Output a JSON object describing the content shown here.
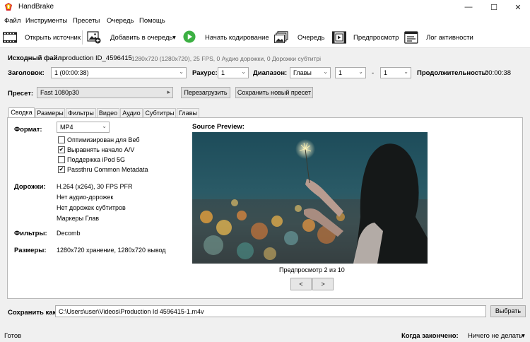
{
  "app": {
    "title": "HandBrake"
  },
  "window_controls": {
    "minimize": "—",
    "maximize": "☐",
    "close": "✕"
  },
  "menu": [
    "Файл",
    "Инструменты",
    "Пресеты",
    "Очередь",
    "Помощь"
  ],
  "toolbar": {
    "open_source": "Открыть источник",
    "add_queue": "Добавить в очередь",
    "add_queue_arrow": "▾",
    "start_encode": "Начать кодирование",
    "queue": "Очередь",
    "preview": "Предпросмотр",
    "activity_log": "Лог активности"
  },
  "source": {
    "label": "Исходный файл:",
    "name": "production ID_4596415",
    "info": "1280x720 (1280x720), 25 FPS, 0 Аудио дорожки, 0 Дорожки субтитрі"
  },
  "title_row": {
    "title_label": "Заголовок:",
    "title_value": "1 (00:00:38)",
    "angle_label": "Ракурс:",
    "angle_value": "1",
    "range_label": "Диапазон:",
    "range_type": "Главы",
    "range_start": "1",
    "range_dash": "-",
    "range_end": "1",
    "duration_label": "Продолжительность:",
    "duration_value": "00:00:38"
  },
  "preset": {
    "label": "Пресет:",
    "value": "Fast 1080p30",
    "arrow": "▸",
    "reload_button": "Перезагрузить",
    "save_new_button": "Сохранить новый пресет"
  },
  "tabs": [
    "Сводка",
    "Размеры",
    "Фильтры",
    "Видео",
    "Аудио",
    "Субтитры",
    "Главы"
  ],
  "summary": {
    "format_label": "Формат:",
    "format_value": "MP4",
    "options": [
      {
        "label": "Оптимизирован для Веб",
        "checked": false
      },
      {
        "label": "Выравнять начало A/V",
        "checked": true
      },
      {
        "label": "Поддержка iPod 5G",
        "checked": false
      },
      {
        "label": "Passthru Common Metadata",
        "checked": true
      }
    ],
    "tracks_label": "Дорожки:",
    "tracks": [
      "H.264 (x264), 30 FPS PFR",
      "Нет аудио-дорожек",
      "Нет дорожек субтитров",
      "Маркеры Глав"
    ],
    "filters_label": "Фильтры:",
    "filters_value": "Decomb",
    "size_label": "Размеры:",
    "size_value": "1280x720 хранение, 1280x720 вывод",
    "preview_title": "Source Preview:",
    "preview_counter": "Предпросмотр 2 из 10",
    "prev_button": "<",
    "next_button": ">"
  },
  "save_as": {
    "label": "Сохранить как:",
    "path": "C:\\Users\\user\\Videos\\Production Id 4596415-1.m4v",
    "browse_button": "Выбрать"
  },
  "status": {
    "left": "Готов",
    "when_done_label": "Когда закончено:",
    "when_done_value": "Ничего не делать",
    "when_done_arrow": "▾"
  },
  "colors": {
    "accent_green": "#3cb043",
    "window_bg": "#f0f0f0"
  }
}
